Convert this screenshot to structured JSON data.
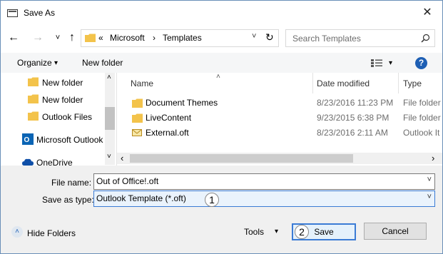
{
  "window": {
    "title": "Save As",
    "close_glyph": "✕"
  },
  "nav": {
    "back": "←",
    "forward": "→",
    "dropdown": "˅",
    "up": "↑",
    "refresh": "↻"
  },
  "address": {
    "prefix": "«",
    "crumbs": [
      "Microsoft",
      "Templates"
    ],
    "separator": "›",
    "dropdown": "˅"
  },
  "search": {
    "placeholder": "Search Templates"
  },
  "toolbar": {
    "organize": "Organize",
    "organize_arrow": "▾",
    "new_folder": "New folder",
    "view_arrow": "▾",
    "help": "?"
  },
  "sidebar": {
    "items": [
      {
        "label": "New folder",
        "icon": "folder-icon"
      },
      {
        "label": "New folder",
        "icon": "folder-icon"
      },
      {
        "label": "Outlook Files",
        "icon": "folder-icon"
      },
      {
        "label": "Microsoft Outlook",
        "icon": "outlook-icon"
      },
      {
        "label": "OneDrive",
        "icon": "onedrive-icon"
      }
    ],
    "scroll_up": "˄",
    "scroll_down": "˅"
  },
  "file_list": {
    "columns": [
      {
        "label": "Name"
      },
      {
        "label": "Date modified"
      },
      {
        "label": "Type"
      }
    ],
    "sort_arrow": "˄",
    "rows": [
      {
        "name": "Document Themes",
        "date": "8/23/2016 11:23 PM",
        "type": "File folder",
        "icon": "folder-icon"
      },
      {
        "name": "LiveContent",
        "date": "9/23/2015 6:38 PM",
        "type": "File folder",
        "icon": "folder-icon"
      },
      {
        "name": "External.oft",
        "date": "8/23/2016 2:11 AM",
        "type": "Outlook It",
        "icon": "envelope-icon"
      }
    ],
    "scroll_left": "‹",
    "scroll_right": "›"
  },
  "form": {
    "file_name_label": "File name:",
    "file_name_value": "Out of Office!.oft",
    "save_type_label": "Save as type:",
    "save_type_value": "Outlook Template (*.oft)",
    "dropdown": "˅"
  },
  "footer": {
    "hide_folders_icon": "˄",
    "hide_folders": "Hide Folders",
    "tools": "Tools",
    "tools_arrow": "▾",
    "save": "Save",
    "cancel": "Cancel"
  },
  "annotations": {
    "step1": "1",
    "step2": "2"
  },
  "colors": {
    "accent": "#3a7bd5",
    "folder": "#f3c34b",
    "help": "#1e5fb4",
    "outlook": "#0a64b4",
    "onedrive": "#0f4fa8"
  }
}
